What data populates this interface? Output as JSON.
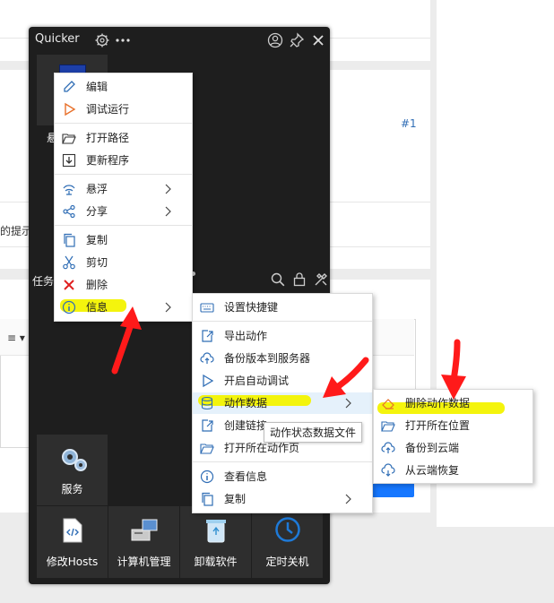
{
  "window": {
    "title": "Quicker"
  },
  "background": {
    "link_text": "#1",
    "partial_text": "的提示",
    "task_label": "任务",
    "format_button": "≡ ▾"
  },
  "tiles": {
    "top_partial_label": "悬",
    "service": "服务",
    "bottom": [
      "修改Hosts",
      "计算机管理",
      "卸载软件",
      "定时关机"
    ]
  },
  "context_menu": {
    "items": [
      {
        "label": "编辑",
        "icon": "pencil-icon"
      },
      {
        "label": "调试运行",
        "icon": "play-icon"
      },
      {
        "label": "打开路径",
        "icon": "folder-open-icon"
      },
      {
        "label": "更新程序",
        "icon": "download-icon"
      },
      {
        "label": "悬浮",
        "icon": "float-icon"
      },
      {
        "label": "分享",
        "icon": "share-icon"
      },
      {
        "label": "复制",
        "icon": "copy-icon"
      },
      {
        "label": "剪切",
        "icon": "scissors-icon"
      },
      {
        "label": "删除",
        "icon": "close-red-icon"
      },
      {
        "label": "信息",
        "icon": "info-icon"
      }
    ]
  },
  "info_submenu": {
    "items": [
      {
        "label": "设置快捷键",
        "icon": "keyboard-icon"
      },
      {
        "label": "导出动作",
        "icon": "export-icon"
      },
      {
        "label": "备份版本到服务器",
        "icon": "cloud-upload-icon"
      },
      {
        "label": "开启自动调试",
        "icon": "play-icon"
      },
      {
        "label": "动作数据",
        "icon": "database-icon"
      },
      {
        "label": "创建链接",
        "icon": "link-icon"
      },
      {
        "label": "打开所在动作页",
        "icon": "folder-open-icon"
      },
      {
        "label": "查看信息",
        "icon": "info-icon"
      },
      {
        "label": "复制",
        "icon": "copy-icon"
      }
    ]
  },
  "data_submenu": {
    "items": [
      {
        "label": "删除动作数据",
        "icon": "eraser-icon"
      },
      {
        "label": "打开所在位置",
        "icon": "folder-open-icon"
      },
      {
        "label": "备份到云端",
        "icon": "cloud-upload-icon"
      },
      {
        "label": "从云端恢复",
        "icon": "cloud-download-icon"
      }
    ]
  },
  "tooltip": {
    "text": "动作状态数据文件"
  },
  "colors": {
    "highlight": "#f3f300",
    "arrow": "#ff1a1a",
    "accent": "#2f6db5",
    "delete": "#e02020"
  }
}
